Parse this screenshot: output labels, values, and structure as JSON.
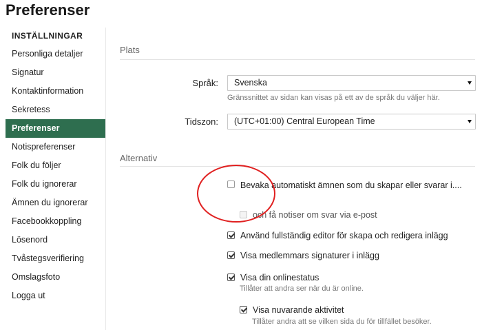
{
  "page": {
    "title": "Preferenser"
  },
  "sidebar": {
    "heading": "INSTÄLLNINGAR",
    "items": [
      {
        "label": "Personliga detaljer"
      },
      {
        "label": "Signatur"
      },
      {
        "label": "Kontaktinformation"
      },
      {
        "label": "Sekretess"
      },
      {
        "label": "Preferenser",
        "active": true
      },
      {
        "label": "Notispreferenser"
      },
      {
        "label": "Folk du följer"
      },
      {
        "label": "Folk du ignorerar"
      },
      {
        "label": "Ämnen du ignorerar"
      },
      {
        "label": "Facebookkoppling"
      },
      {
        "label": "Lösenord"
      },
      {
        "label": "Tvåstegsverifiering"
      },
      {
        "label": "Omslagsfoto"
      },
      {
        "label": "Logga ut"
      }
    ]
  },
  "plats": {
    "title": "Plats",
    "language": {
      "label": "Språk:",
      "value": "Svenska",
      "hint": "Gränssnittet av sidan kan visas på ett av de språk du väljer här."
    },
    "timezone": {
      "label": "Tidszon:",
      "value": "(UTC+01:00) Central European Time"
    }
  },
  "alternativ": {
    "title": "Alternativ",
    "options": {
      "watch_topics": {
        "label": "Bevaka automatiskt ämnen som du skapar eller svarar i....",
        "checked": false
      },
      "notify_replies": {
        "label": "och få notiser om svar via e-post",
        "checked": false,
        "disabled": true
      },
      "full_editor": {
        "label": "Använd fullständig editor för skapa och redigera inlägg",
        "checked": true
      },
      "show_signatures": {
        "label": "Visa medlemmars signaturer i inlägg",
        "checked": true
      },
      "online_status": {
        "label": "Visa din onlinestatus",
        "checked": true,
        "hint": "Tillåter att andra ser när du är online."
      },
      "current_activity": {
        "label": "Visa nuvarande aktivitet",
        "checked": true,
        "hint": "Tillåter andra att se vilken sida du för tillfället besöker."
      }
    }
  },
  "colors": {
    "accent": "#2e6e4f",
    "annotation": "#e02020"
  }
}
